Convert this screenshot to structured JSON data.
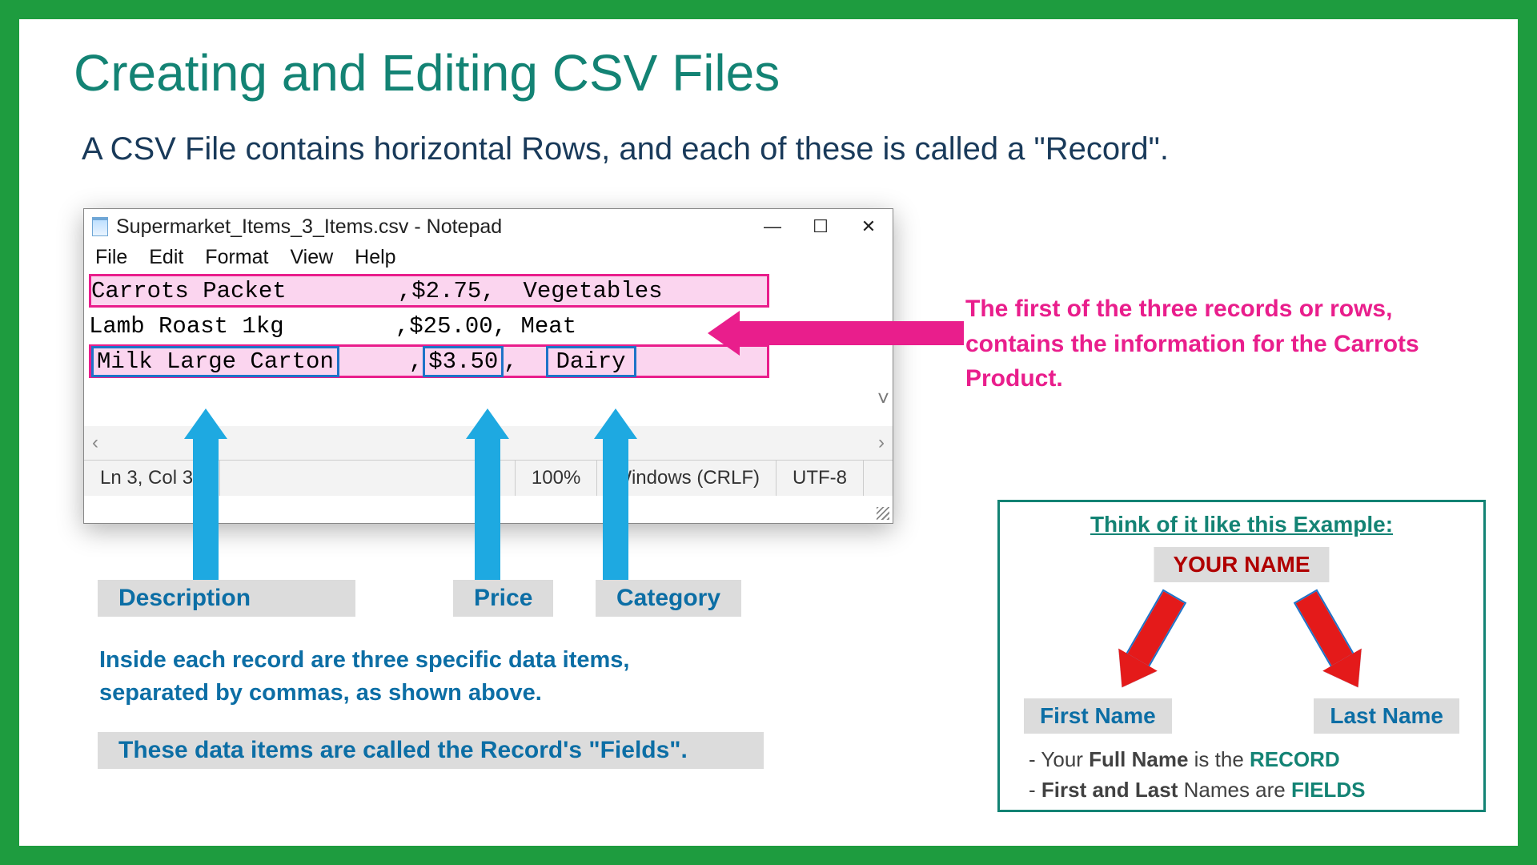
{
  "slide": {
    "title": "Creating and Editing CSV Files",
    "subtitle": "A CSV File contains horizontal Rows, and each of these is called a \"Record\"."
  },
  "notepad": {
    "window_title": "Supermarket_Items_3_Items.csv - Notepad",
    "menu": {
      "file": "File",
      "edit": "Edit",
      "format": "Format",
      "view": "View",
      "help": "Help"
    },
    "rows": {
      "r1": "Carrots Packet        ,$2.75,  Vegetables",
      "r2": "Lamb Roast 1kg        ,$25.00, Meat",
      "r3_desc": "Milk Large Carton",
      "r3_sep1": "     ,",
      "r3_price": "$3.50",
      "r3_sep2": ",  ",
      "r3_cat": "Dairy"
    },
    "status": {
      "pos": "Ln 3, Col 39",
      "zoom": "100%",
      "eol": "Windows (CRLF)",
      "enc": "UTF-8"
    },
    "sys": {
      "min": "—",
      "max": "☐",
      "close": "✕"
    },
    "scroll_left": "‹",
    "scroll_right": "›",
    "scroll_down": "˅"
  },
  "labels": {
    "description": "Description",
    "price": "Price",
    "category": "Category",
    "inside_records": "Inside each record are three specific data items, separated by commas, as shown above.",
    "fields_def": "These data items are called the Record's \"Fields\".",
    "pink_note": "The first of the three records or rows, contains the information for the Carrots Product."
  },
  "example": {
    "heading": "Think of it like this Example:",
    "top": "YOUR NAME",
    "first": "First Name",
    "last": "Last Name",
    "line1_prefix": "- Your ",
    "line1_b1": "Full Name",
    "line1_mid": " is the ",
    "line1_b2": "RECORD",
    "line2_prefix": "- ",
    "line2_b1": "First and Last",
    "line2_mid": " Names are ",
    "line2_b2": "FIELDS"
  }
}
